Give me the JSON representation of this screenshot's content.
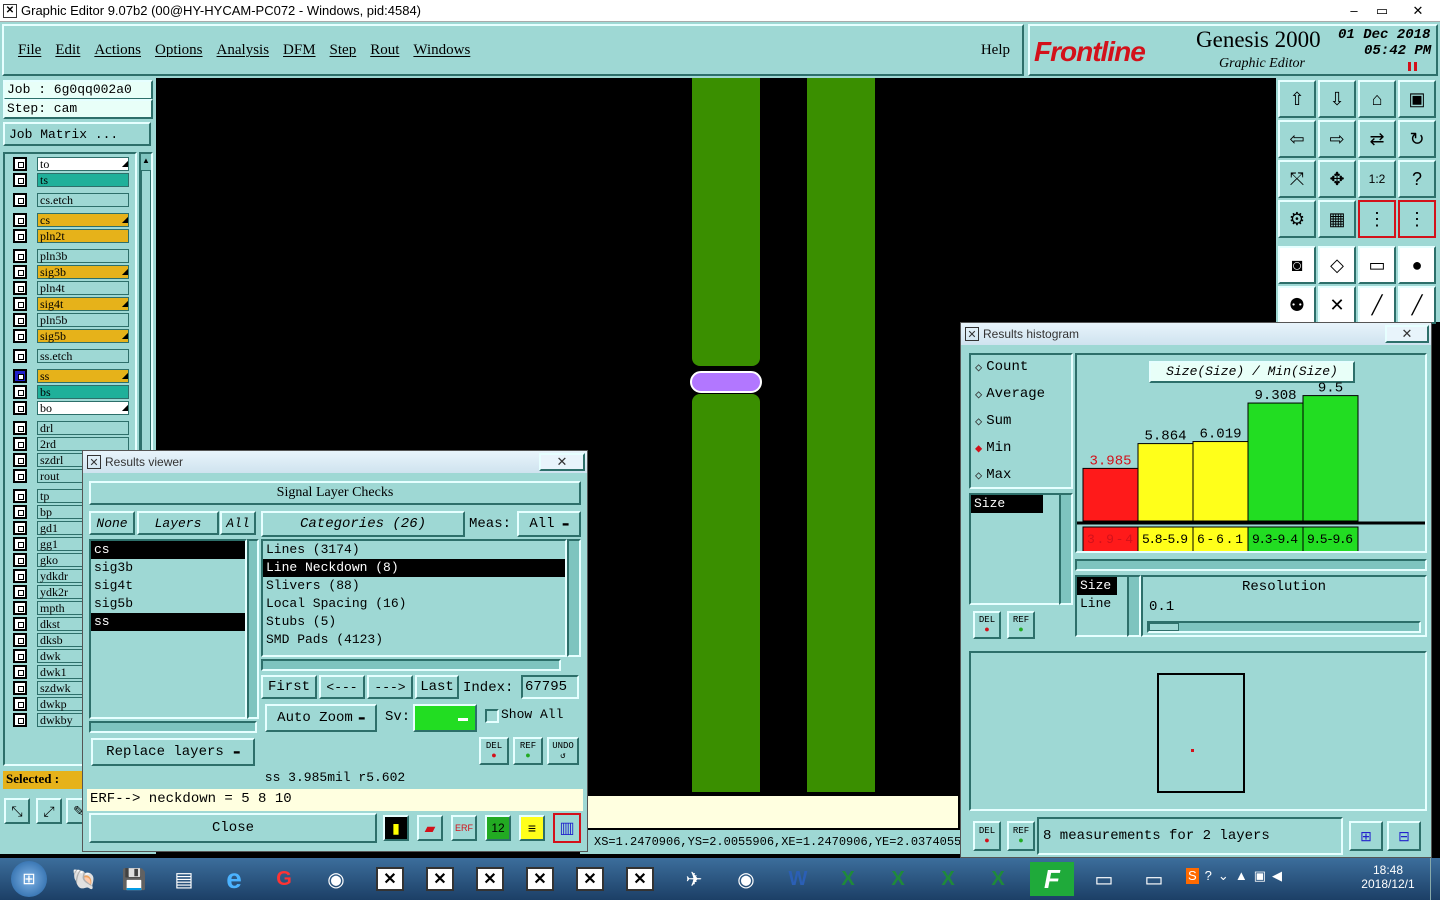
{
  "titlebar": {
    "title": "Graphic Editor 9.07b2 (00@HY-HYCAM-PC072 - Windows, pid:4584)",
    "min": "‒",
    "max": "▭",
    "close": "✕"
  },
  "menu": [
    "File",
    "Edit",
    "Actions",
    "Options",
    "Analysis",
    "DFM",
    "Step",
    "Rout",
    "Windows"
  ],
  "help": "Help",
  "logo": {
    "brand": "Frontline",
    "product": "Genesis 2000",
    "sub": "Graphic Editor",
    "date": "01 Dec 2018",
    "time": "05:42 PM"
  },
  "job": {
    "job_label": "Job : 6g0qq002a0",
    "step_label": "Step: cam",
    "matrix_btn": "Job Matrix ..."
  },
  "layers": [
    {
      "name": "to",
      "color": "#ffffff",
      "mark": "◢"
    },
    {
      "name": "ts",
      "color": "#1fb09a",
      "mark": ""
    },
    {
      "name": "cs.etch",
      "color": "#9ed8d4",
      "mark": ""
    },
    {
      "name": "cs",
      "color": "#e6b21a",
      "mark": "◢"
    },
    {
      "name": "pln2t",
      "color": "#e6b21a",
      "mark": ""
    },
    {
      "name": "pln3b",
      "color": "#9ed8d4",
      "mark": ""
    },
    {
      "name": "sig3b",
      "color": "#e6b21a",
      "mark": "◢"
    },
    {
      "name": "pln4t",
      "color": "#9ed8d4",
      "mark": ""
    },
    {
      "name": "sig4t",
      "color": "#e6b21a",
      "mark": "◢"
    },
    {
      "name": "pln5b",
      "color": "#9ed8d4",
      "mark": ""
    },
    {
      "name": "sig5b",
      "color": "#e6b21a",
      "mark": "◢"
    },
    {
      "name": "ss.etch",
      "color": "#9ed8d4",
      "mark": ""
    },
    {
      "name": "ss",
      "color": "#e6b21a",
      "mark": "◢"
    },
    {
      "name": "bs",
      "color": "#1fb09a",
      "mark": ""
    },
    {
      "name": "bo",
      "color": "#ffffff",
      "mark": "◢"
    },
    {
      "name": "drl",
      "color": "#9ed8d4",
      "mark": ""
    },
    {
      "name": "2rd",
      "color": "#9ed8d4",
      "mark": ""
    },
    {
      "name": "szdrl",
      "color": "#9ed8d4",
      "mark": ""
    },
    {
      "name": "rout",
      "color": "#9ed8d4",
      "mark": ""
    },
    {
      "name": "tp",
      "color": "#9ed8d4",
      "mark": ""
    },
    {
      "name": "bp",
      "color": "#9ed8d4",
      "mark": ""
    },
    {
      "name": "gd1",
      "color": "#9ed8d4",
      "mark": ""
    },
    {
      "name": "gg1",
      "color": "#9ed8d4",
      "mark": ""
    },
    {
      "name": "gko",
      "color": "#9ed8d4",
      "mark": ""
    },
    {
      "name": "ydkdr",
      "color": "#9ed8d4",
      "mark": ""
    },
    {
      "name": "ydk2r",
      "color": "#9ed8d4",
      "mark": ""
    },
    {
      "name": "mpth",
      "color": "#9ed8d4",
      "mark": ""
    },
    {
      "name": "dkst",
      "color": "#9ed8d4",
      "mark": ""
    },
    {
      "name": "dksb",
      "color": "#9ed8d4",
      "mark": ""
    },
    {
      "name": "dwk",
      "color": "#9ed8d4",
      "mark": ""
    },
    {
      "name": "dwk1",
      "color": "#9ed8d4",
      "mark": ""
    },
    {
      "name": "szdwk",
      "color": "#9ed8d4",
      "mark": ""
    },
    {
      "name": "dwkp",
      "color": "#9ed8d4",
      "mark": ""
    },
    {
      "name": "dwkby",
      "color": "#9ed8d4",
      "mark": ""
    }
  ],
  "selected_label": "Selected :",
  "results_viewer": {
    "title": "Results viewer",
    "header": "Signal Layer Checks",
    "none": "None",
    "layers": "Layers",
    "all": "All",
    "layer_list": [
      "cs",
      "sig3b",
      "sig4t",
      "sig5b",
      "ss"
    ],
    "categories": "Categories (26)",
    "meas_label": "Meas:",
    "meas_value": "All",
    "category_list": [
      "Lines (3174)",
      "Line Neckdown (8)",
      "Slivers (88)",
      "Local Spacing (16)",
      "Stubs (5)",
      "SMD Pads (4123)"
    ],
    "first": "First",
    "prev": "<---",
    "next": "--->",
    "last": "Last",
    "index_label": "Index:",
    "index_value": "67795",
    "auto_zoom": "Auto Zoom",
    "sv_label": "Sv:",
    "show_all": "Show All",
    "replace": "Replace layers",
    "del": "DEL",
    "ref": "REF",
    "undo": "UNDO",
    "status": "ss 3.985mil   r5.602",
    "erf": "ERF--> neckdown = 5 8 10",
    "close": "Close"
  },
  "histogram": {
    "title": "Results histogram",
    "options": [
      "Count",
      "Average",
      "Sum",
      "Min",
      "Max"
    ],
    "selected_option": "Min",
    "field": "Size",
    "del": "DEL",
    "ref": "REF",
    "resolution_label": "Resolution",
    "resolution_value": "0.1",
    "axis_items": [
      "Size",
      "Line"
    ],
    "measurements": "8 measurements for 2 layers"
  },
  "chart_data": {
    "type": "bar",
    "title": "Size(Size) / Min(Size)",
    "categories": [
      "3.9-4",
      "5.8-5.9",
      "6-6.1",
      "9.3-9.4",
      "9.5-9.6"
    ],
    "values": [
      3.985,
      5.864,
      6.019,
      9.308,
      9.5
    ],
    "value_labels": [
      "3.985",
      "5.864",
      "6.019",
      "9.308",
      "9.5"
    ],
    "colors": [
      "#ff1a1a",
      "#ffff1a",
      "#ffff1a",
      "#22dd22",
      "#22dd22"
    ]
  },
  "coords": "XS=1.2470906,YS=2.0055906,XE=1.2470906,YE=2.0374055",
  "tray": {
    "time": "18:48",
    "date": "2018/12/1"
  }
}
